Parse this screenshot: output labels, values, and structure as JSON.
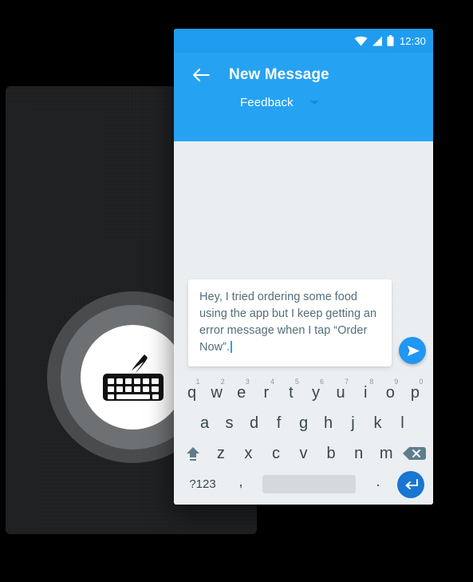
{
  "status_bar": {
    "time": "12:30",
    "icons": [
      "wifi-icon",
      "signal-icon",
      "battery-icon"
    ]
  },
  "app_bar": {
    "back_icon": "back-arrow-icon",
    "title": "New Message",
    "category_label": "Feedback",
    "caret_icon": "chevron-down-icon",
    "background_color": "#26a2f2"
  },
  "conversation": {
    "message_text": "Hey, I tried ordering some food using the app but I keep getting an error message when I tap “Order Now”.",
    "send_icon": "send-icon",
    "send_button_color": "#2196f3",
    "background_color": "#eceff1"
  },
  "keyboard": {
    "row1": [
      {
        "letter": "q",
        "num": "1"
      },
      {
        "letter": "w",
        "num": "2"
      },
      {
        "letter": "e",
        "num": "3"
      },
      {
        "letter": "r",
        "num": "4"
      },
      {
        "letter": "t",
        "num": "5"
      },
      {
        "letter": "y",
        "num": "6"
      },
      {
        "letter": "u",
        "num": "7"
      },
      {
        "letter": "i",
        "num": "8"
      },
      {
        "letter": "o",
        "num": "9"
      },
      {
        "letter": "p",
        "num": "0"
      }
    ],
    "row2": [
      "a",
      "s",
      "d",
      "f",
      "g",
      "h",
      "j",
      "k",
      "l"
    ],
    "row3_letters": [
      "z",
      "x",
      "c",
      "v",
      "b",
      "n",
      "m"
    ],
    "shift_icon": "shift-icon",
    "backspace_icon": "backspace-icon",
    "symbols_label": "?123",
    "comma_label": ",",
    "period_label": ".",
    "space_label": "",
    "enter_icon": "enter-icon",
    "enter_color": "#1976d2",
    "key_text_color": "#37474f"
  },
  "illustration": {
    "panel_color": "#1f2022",
    "ring_outer_color": "#4a4b4d",
    "ring_inner_color": "#6e7173",
    "ring_center_color": "#ffffff",
    "glyph_icon": "keyboard-with-swipe-icon"
  }
}
